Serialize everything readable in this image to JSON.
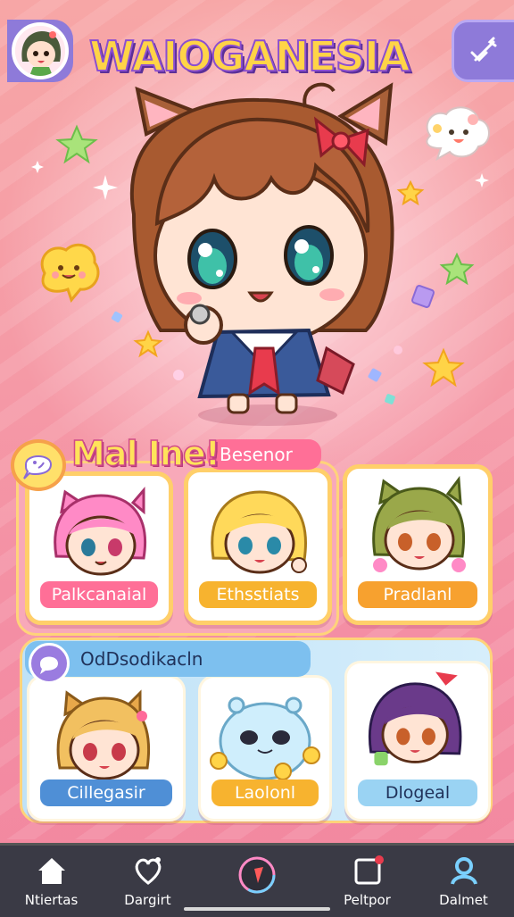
{
  "header": {
    "title": "WAIOGANESIA",
    "avatar_icon": "player-avatar",
    "menu_icon": "collapse-icon"
  },
  "favorites": {
    "title": "Mal Ine!",
    "tab_label": "Besenor",
    "cards": [
      {
        "name": "Palkcanaial",
        "label_color": "#ff6f97"
      },
      {
        "name": "Ethsstiats",
        "label_color": "#f7b32f"
      },
      {
        "name": "Pradlanl",
        "label_color": "#f7a12f"
      }
    ]
  },
  "second_section": {
    "tab_label": "OdDsodikacln",
    "cards": [
      {
        "name": "Cillegasir",
        "label_color": "#4f8fd6"
      },
      {
        "name": "Laolonl",
        "label_color": "#f7b32f"
      },
      {
        "name": "Dlogeal",
        "label_color": "#9ad3f3"
      }
    ]
  },
  "bottom_nav": {
    "items": [
      {
        "label": "Ntiertas",
        "icon": "home-icon"
      },
      {
        "label": "Dargirt",
        "icon": "heart-icon"
      },
      {
        "label": "",
        "icon": "center-play-icon"
      },
      {
        "label": "Peltpor",
        "icon": "inbox-icon"
      },
      {
        "label": "Dalmet",
        "icon": "profile-icon"
      }
    ]
  }
}
